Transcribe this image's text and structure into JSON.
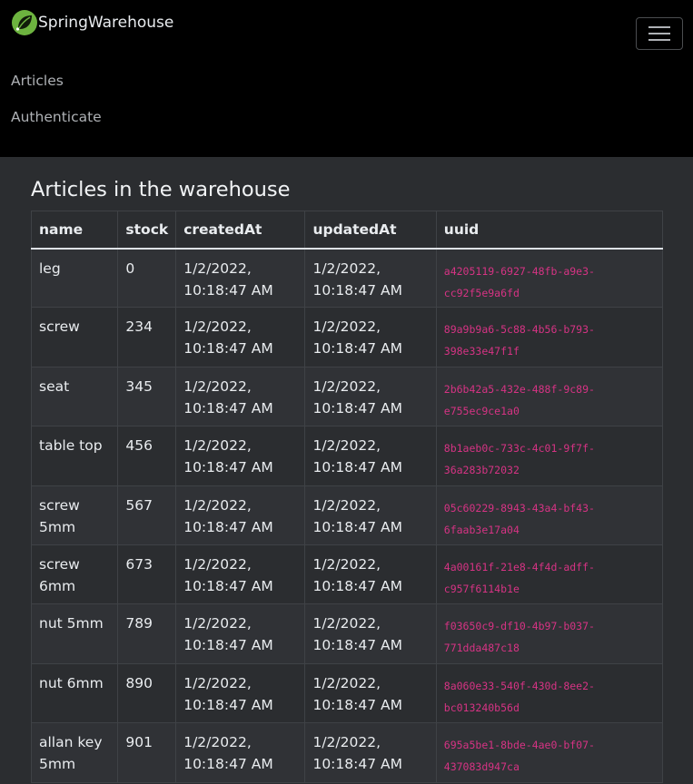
{
  "navbar": {
    "brand": "SpringWarehouse",
    "links": [
      "Articles",
      "Authenticate"
    ],
    "logo_icon": "spring-leaf-icon",
    "toggler_icon": "hamburger-menu-icon",
    "accent": "#6db33f"
  },
  "main": {
    "title": "Articles in the warehouse",
    "columns": [
      "name",
      "stock",
      "createdAt",
      "updatedAt",
      "uuid"
    ],
    "rows": [
      {
        "name": "leg",
        "stock": "0",
        "createdAt": "1/2/2022, 10:18:47 AM",
        "updatedAt": "1/2/2022, 10:18:47 AM",
        "uuid": "a4205119-6927-48fb-a9e3-cc92f5e9a6fd"
      },
      {
        "name": "screw",
        "stock": "234",
        "createdAt": "1/2/2022, 10:18:47 AM",
        "updatedAt": "1/2/2022, 10:18:47 AM",
        "uuid": "89a9b9a6-5c88-4b56-b793-398e33e47f1f"
      },
      {
        "name": "seat",
        "stock": "345",
        "createdAt": "1/2/2022, 10:18:47 AM",
        "updatedAt": "1/2/2022, 10:18:47 AM",
        "uuid": "2b6b42a5-432e-488f-9c89-e755ec9ce1a0"
      },
      {
        "name": "table top",
        "stock": "456",
        "createdAt": "1/2/2022, 10:18:47 AM",
        "updatedAt": "1/2/2022, 10:18:47 AM",
        "uuid": "8b1aeb0c-733c-4c01-9f7f-36a283b72032"
      },
      {
        "name": "screw 5mm",
        "stock": "567",
        "createdAt": "1/2/2022, 10:18:47 AM",
        "updatedAt": "1/2/2022, 10:18:47 AM",
        "uuid": "05c60229-8943-43a4-bf43-6faab3e17a04"
      },
      {
        "name": "screw 6mm",
        "stock": "673",
        "createdAt": "1/2/2022, 10:18:47 AM",
        "updatedAt": "1/2/2022, 10:18:47 AM",
        "uuid": "4a00161f-21e8-4f4d-adff-c957f6114b1e"
      },
      {
        "name": "nut 5mm",
        "stock": "789",
        "createdAt": "1/2/2022, 10:18:47 AM",
        "updatedAt": "1/2/2022, 10:18:47 AM",
        "uuid": "f03650c9-df10-4b97-b037-771dda487c18"
      },
      {
        "name": "nut 6mm",
        "stock": "890",
        "createdAt": "1/2/2022, 10:18:47 AM",
        "updatedAt": "1/2/2022, 10:18:47 AM",
        "uuid": "8a060e33-540f-430d-8ee2-bc013240b56d"
      },
      {
        "name": "allan key 5mm",
        "stock": "901",
        "createdAt": "1/2/2022, 10:18:47 AM",
        "updatedAt": "1/2/2022, 10:18:47 AM",
        "uuid": "695a5be1-8bde-4ae0-bf07-437083d947ca"
      }
    ]
  }
}
